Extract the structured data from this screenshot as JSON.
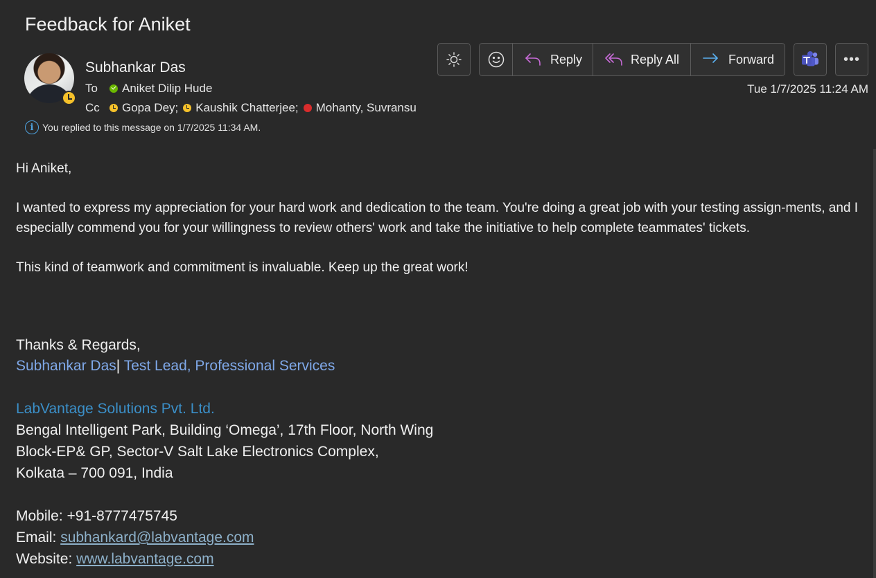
{
  "subject": "Feedback for Aniket",
  "sender": "Subhankar Das",
  "to_label": "To",
  "to": [
    {
      "name": "Aniket Dilip Hude",
      "status": "available"
    }
  ],
  "cc_label": "Cc",
  "cc": [
    {
      "name": "Gopa Dey;",
      "status": "away"
    },
    {
      "name": "Kaushik Chatterjee;",
      "status": "away"
    },
    {
      "name": "Mohanty, Suvransu",
      "status": "busy"
    }
  ],
  "info_message": "You replied to this message on 1/7/2025 11:34 AM.",
  "toolbar": {
    "reply": "Reply",
    "reply_all": "Reply All",
    "forward": "Forward",
    "theme_icon": "sun-icon",
    "reaction_icon": "smiley-icon",
    "teams_icon": "teams-icon",
    "more": "•••"
  },
  "datetime": "Tue 1/7/2025 11:24 AM",
  "body": {
    "greeting": "Hi Aniket,",
    "para1": "I wanted to express my appreciation for your hard work and dedication to the team. You're doing a great job with your testing assign-ments, and I especially commend you for your willingness to review others' work and take the initiative to help complete teammates' tickets.",
    "para2": "This kind of teamwork and commitment is invaluable. Keep up the great work!"
  },
  "signature": {
    "closing": "Thanks & Regards,",
    "name": "Subhankar Das",
    "separator": "|",
    "title": " Test Lead, Professional Services",
    "company": "LabVantage Solutions Pvt. Ltd.",
    "address1": "Bengal Intelligent Park, Building ‘Omega’, 17th Floor, North Wing",
    "address2": "Block-EP& GP, Sector-V Salt Lake Electronics Complex,",
    "address3": "Kolkata – 700 091, India",
    "mobile_label": "Mobile: ",
    "mobile": "+91-8777475745",
    "email_label": "Email: ",
    "email": "subhankard@labvantage.com",
    "website_label": "Website: ",
    "website": "www.labvantage.com"
  },
  "colors": {
    "background": "#292929",
    "accent_blue": "#4fa3e0",
    "reply_icon": "#c86bd8",
    "forward_icon": "#5ab0f0",
    "link_blue": "#7fa8e8",
    "company_blue": "#3b8fc8"
  }
}
